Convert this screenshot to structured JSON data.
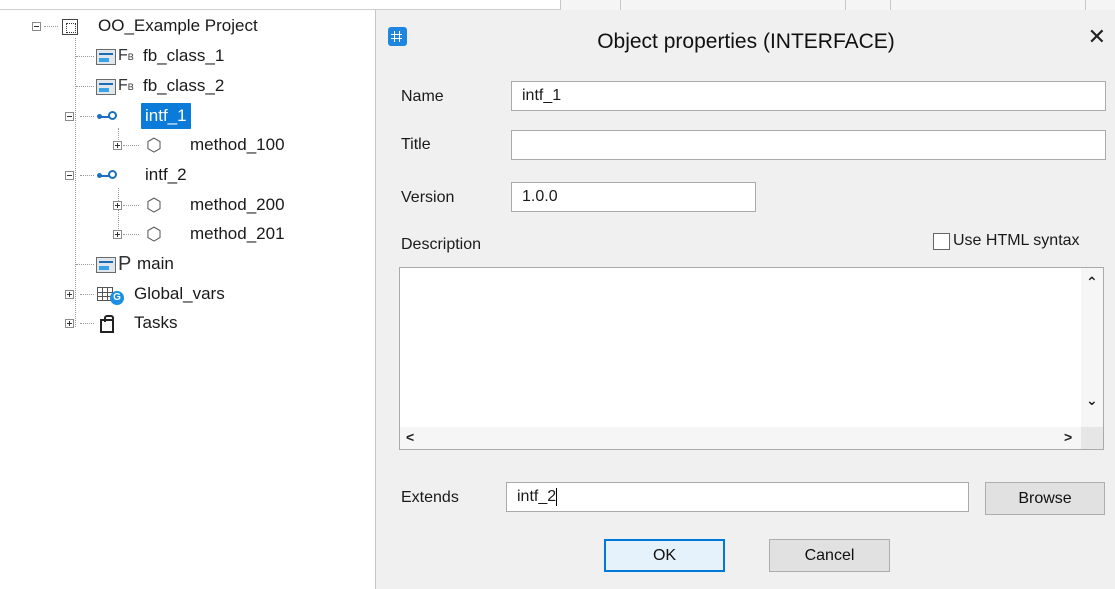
{
  "tree": {
    "project": "OO_Example Project",
    "fb_class_1": "fb_class_1",
    "fb_class_2": "fb_class_2",
    "fb_glyph": "F",
    "fb_sub": "B",
    "intf_1": "intf_1",
    "method_100": "method_100",
    "intf_2": "intf_2",
    "method_200": "method_200",
    "method_201": "method_201",
    "main_glyph": "P",
    "main": "main",
    "global_vars": "Global_vars",
    "g_glyph": "G",
    "tasks": "Tasks"
  },
  "dialog": {
    "title": "Object properties (INTERFACE)",
    "close": "✕",
    "name_label": "Name",
    "name_value": "intf_1",
    "title_label": "Title",
    "title_value": "",
    "version_label": "Version",
    "version_value": "1.0.0",
    "description_label": "Description",
    "html_syntax_label": "Use HTML syntax",
    "html_syntax_checked": false,
    "extends_label": "Extends",
    "extends_value": "intf_2",
    "browse": "Browse",
    "ok": "OK",
    "cancel": "Cancel",
    "scroll_up": "⌃",
    "scroll_down": "⌄",
    "scroll_left": "<",
    "scroll_right": ">"
  },
  "colors": {
    "selection": "#0a7bd8",
    "accent_icon": "#1f86e0",
    "dialog_bg": "#f0f0f0",
    "ok_border": "#0078d7"
  },
  "icons": {
    "project": "project-icon",
    "fb_class": "function-block-icon",
    "interface": "interface-lollipop-icon",
    "method": "cube-icon",
    "program": "program-icon",
    "global_vars": "table-icon",
    "tasks": "bag-icon",
    "dialog": "app-icon"
  }
}
